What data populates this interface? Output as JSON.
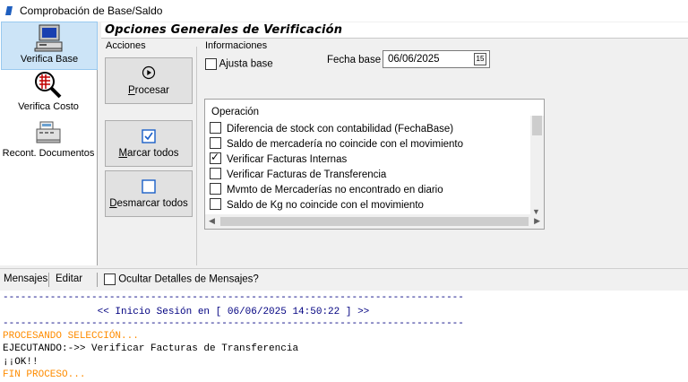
{
  "window": {
    "title": "Comprobación de Base/Saldo"
  },
  "sidebar": {
    "items": [
      {
        "label": "Verifica Base",
        "icon": "computer-icon",
        "selected": true
      },
      {
        "label": "Verifica Costo",
        "icon": "magnifier-chart-icon",
        "selected": false
      },
      {
        "label": "Recont. Documentos",
        "icon": "cash-register-icon",
        "selected": false
      }
    ]
  },
  "header": {
    "title": "Opciones Generales de Verificación"
  },
  "acciones": {
    "label": "Acciones",
    "procesar": {
      "label_first": "P",
      "label_rest": "rocesar"
    },
    "marcar": {
      "label_first": "M",
      "label_rest": "arcar todos"
    },
    "desmarcar": {
      "label_first": "D",
      "label_rest": "esmarcar todos"
    }
  },
  "informaciones": {
    "label": "Informaciones",
    "ajusta_base": {
      "label": "Ajusta base",
      "checked": false
    },
    "fecha_base": {
      "label": "Fecha base",
      "value": "06/06/2025",
      "calendar_icon": "15"
    }
  },
  "operacion": {
    "header": "Operación",
    "items": [
      {
        "label": "Diferencia de stock con contabilidad (FechaBase)",
        "checked": false
      },
      {
        "label": "Saldo de mercadería no coincide con el movimiento",
        "checked": false
      },
      {
        "label": "Verificar Facturas Internas",
        "checked": true
      },
      {
        "label": "Verificar Facturas de Transferencia",
        "checked": false
      },
      {
        "label": "Mvmto de Mercaderías no encontrado en diario",
        "checked": false
      },
      {
        "label": "Saldo de Kg no coincide con el movimiento",
        "checked": false
      }
    ]
  },
  "messages_bar": {
    "mensajes": "Mensajes",
    "editar": "Editar",
    "ocultar": {
      "label": "Ocultar Detalles de Mensajes?",
      "checked": false
    }
  },
  "console": {
    "lines": [
      {
        "text": "------------------------------------------------------------------------------",
        "color": "#000080"
      },
      {
        "text": "                << Inicio Sesión en [ 06/06/2025 14:50:22 ] >>",
        "color": "#000080"
      },
      {
        "text": "------------------------------------------------------------------------------",
        "color": "#000080"
      },
      {
        "text": "PROCESANDO SELECCIÓN...",
        "color": "#ff8c00"
      },
      {
        "text": "EJECUTANDO:->> Verificar Facturas de Transferencia",
        "color": "#000000"
      },
      {
        "text": "¡¡OK!!",
        "color": "#000000"
      },
      {
        "text": "FIN PROCESO...",
        "color": "#ff8c00"
      }
    ]
  }
}
